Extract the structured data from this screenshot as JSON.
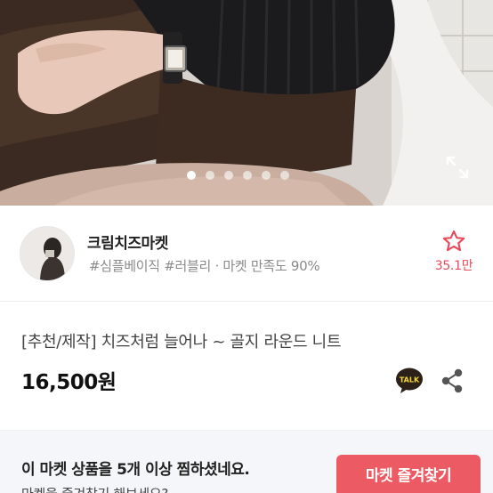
{
  "hero": {
    "slides_total": 6,
    "active_slide": 1,
    "expand_icon": "expand-icon"
  },
  "seller": {
    "name": "크림치즈마켓",
    "meta": "#심플베이직 #러블리 · 마켓 만족도 90%",
    "favorite_icon": "star-outline-icon",
    "favorite_count": "35.1만",
    "accent_color": "#e8495a"
  },
  "product": {
    "title": "[추천/제작] 치즈처럼 늘어나 ~ 골지 라운드 니트",
    "price": "16,500원",
    "talk_icon": "kakaotalk-icon",
    "talk_label": "TALK",
    "share_icon": "share-icon"
  },
  "banner": {
    "text": "이 마켓 상품을 5개 이상 찜하셨네요.",
    "sub": "마켓을 즐겨찾기 해보세요?",
    "button_label": "마켓 즐겨찾기",
    "button_color": "#ec5a63"
  }
}
